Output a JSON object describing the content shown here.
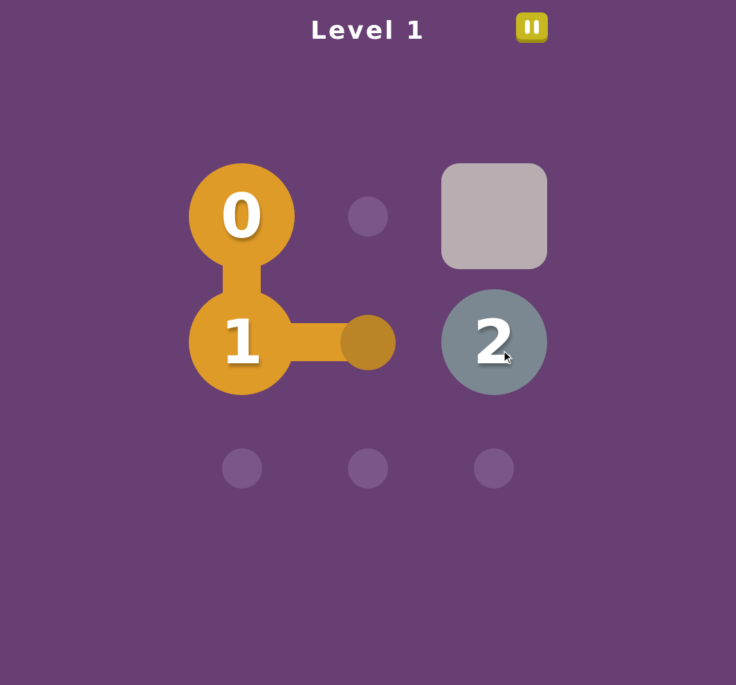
{
  "header": {
    "level_label": "Level 1",
    "pause_icon": "pause-icon"
  },
  "board": {
    "rows": 3,
    "cols": 3,
    "nodes": [
      {
        "label": "0",
        "row": 0,
        "col": 0,
        "state": "active"
      },
      {
        "label": "1",
        "row": 1,
        "col": 0,
        "state": "active"
      },
      {
        "label": "2",
        "row": 1,
        "col": 2,
        "state": "inactive"
      }
    ],
    "blocked_cells": [
      {
        "row": 0,
        "col": 2
      }
    ],
    "empty_slots": [
      {
        "row": 0,
        "col": 1
      },
      {
        "row": 2,
        "col": 0
      },
      {
        "row": 2,
        "col": 1
      },
      {
        "row": 2,
        "col": 2
      }
    ],
    "path": [
      {
        "row": 0,
        "col": 0
      },
      {
        "row": 1,
        "col": 0
      },
      {
        "row": 1,
        "col": 1
      }
    ]
  },
  "colors": {
    "background": "#673f73",
    "active_node": "#df9b28",
    "path_head": "#bb8427",
    "inactive_node": "#7b8891",
    "blocked_tile": "#b8adb0",
    "empty_slot": "#7a5788",
    "pause_button": "#c7b820"
  }
}
